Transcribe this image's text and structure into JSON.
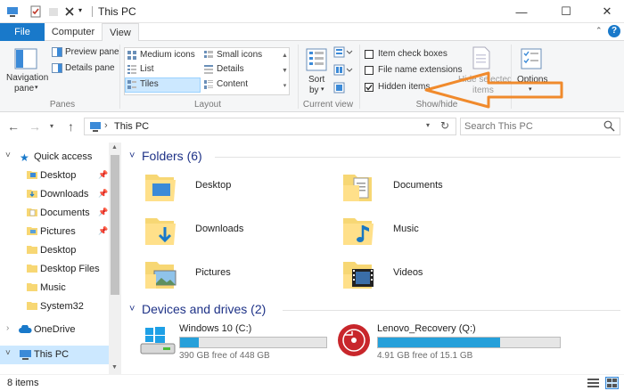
{
  "window": {
    "title": "This PC",
    "minimize_glyph": "—",
    "maximize_glyph": "☐",
    "close_glyph": "✕"
  },
  "ribbon_tabs": [
    "File",
    "Computer",
    "View"
  ],
  "ribbon_help_glyph": "?",
  "ribbon": {
    "panes": {
      "navigation_pane_line1": "Navigation",
      "navigation_pane_line2": "pane",
      "preview_pane": "Preview pane",
      "details_pane": "Details pane",
      "label": "Panes"
    },
    "layout": {
      "options": [
        "Medium icons",
        "Small icons",
        "List",
        "Details",
        "Tiles",
        "Content"
      ],
      "selected": "Tiles",
      "label": "Layout"
    },
    "current_view": {
      "sort_line1": "Sort",
      "sort_line2": "by",
      "label": "Current view"
    },
    "show_hide": {
      "item_check_boxes": "Item check boxes",
      "file_name_extensions": "File name extensions",
      "hidden_items": "Hidden items",
      "item_check_boxes_checked": false,
      "file_name_extensions_checked": false,
      "hidden_items_checked": true,
      "hide_selected_line1": "Hide selected",
      "hide_selected_line2": "items",
      "label": "Show/hide"
    },
    "options_label": "Options"
  },
  "address": {
    "path": "This PC",
    "search_placeholder": "Search This PC"
  },
  "nav_pane": {
    "items": [
      {
        "label": "Quick access",
        "pinned": false,
        "icon": "star-icon"
      },
      {
        "label": "Desktop",
        "pinned": true,
        "icon": "folder-icon"
      },
      {
        "label": "Downloads",
        "pinned": true,
        "icon": "folder-icon"
      },
      {
        "label": "Documents",
        "pinned": true,
        "icon": "folder-icon"
      },
      {
        "label": "Pictures",
        "pinned": true,
        "icon": "folder-icon"
      },
      {
        "label": "Desktop",
        "pinned": false,
        "icon": "folder-icon"
      },
      {
        "label": "Desktop Files",
        "pinned": false,
        "icon": "folder-icon"
      },
      {
        "label": "Music",
        "pinned": false,
        "icon": "folder-icon"
      },
      {
        "label": "System32",
        "pinned": false,
        "icon": "folder-icon"
      },
      {
        "label": "OneDrive",
        "pinned": false,
        "icon": "cloud-icon"
      },
      {
        "label": "This PC",
        "pinned": false,
        "icon": "pc-icon"
      }
    ],
    "selected": "This PC"
  },
  "content": {
    "folders_header": "Folders (6)",
    "folders": [
      "Desktop",
      "Documents",
      "Downloads",
      "Music",
      "Pictures",
      "Videos"
    ],
    "drives_header": "Devices and drives (2)",
    "drives": [
      {
        "name": "Windows 10 (C:)",
        "free": "390 GB free of 448 GB",
        "used_fraction": 0.13
      },
      {
        "name": "Lenovo_Recovery (Q:)",
        "free": "4.91 GB free of 15.1 GB",
        "used_fraction": 0.67
      }
    ]
  },
  "status": {
    "text": "8 items"
  },
  "colors": {
    "accent": "#1979ca",
    "selection": "#cce8ff",
    "header_text": "#1e3287",
    "drive_bar": "#26a0da",
    "folder": "#f7d774",
    "annotation_arrow": "#f08a2c"
  }
}
